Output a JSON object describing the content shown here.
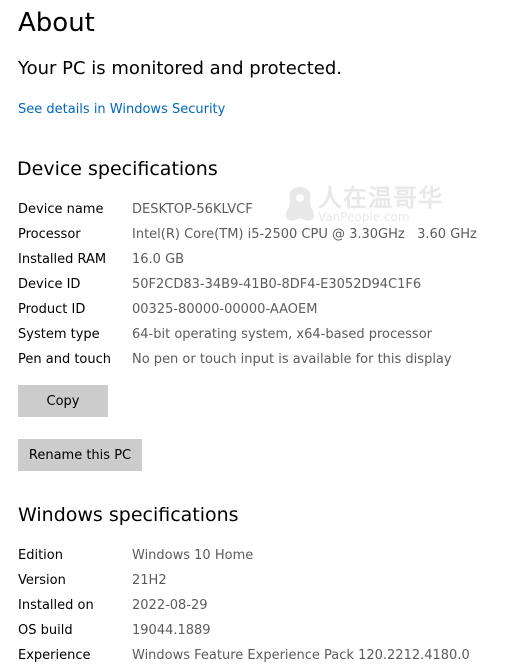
{
  "page": {
    "title": "About",
    "protection_status": "Your PC is monitored and protected.",
    "security_link": "See details in Windows Security"
  },
  "device_specs": {
    "heading": "Device specifications",
    "rows": [
      {
        "label": "Device name",
        "value": "DESKTOP-56KLVCF"
      },
      {
        "label": "Processor",
        "value": "Intel(R) Core(TM) i5-2500 CPU @ 3.30GHz   3.60 GHz"
      },
      {
        "label": "Installed RAM",
        "value": "16.0 GB"
      },
      {
        "label": "Device ID",
        "value": "50F2CD83-34B9-41B0-8DF4-E3052D94C1F6"
      },
      {
        "label": "Product ID",
        "value": "00325-80000-00000-AAOEM"
      },
      {
        "label": "System type",
        "value": "64-bit operating system, x64-based processor"
      },
      {
        "label": "Pen and touch",
        "value": "No pen or touch input is available for this display"
      }
    ],
    "copy_label": "Copy",
    "rename_label": "Rename this PC"
  },
  "windows_specs": {
    "heading": "Windows specifications",
    "rows": [
      {
        "label": "Edition",
        "value": "Windows 10 Home"
      },
      {
        "label": "Version",
        "value": "21H2"
      },
      {
        "label": "Installed on",
        "value": "2022-08-29"
      },
      {
        "label": "OS build",
        "value": "19044.1889"
      },
      {
        "label": "Experience",
        "value": "Windows Feature Experience Pack 120.2212.4180.0"
      }
    ]
  },
  "watermark": {
    "title": "人在温哥华",
    "subtitle": "VanPeople.com"
  },
  "colors": {
    "link": "#0067c0",
    "value_text": "#5c5c5c",
    "button_bg": "#cccccc"
  }
}
